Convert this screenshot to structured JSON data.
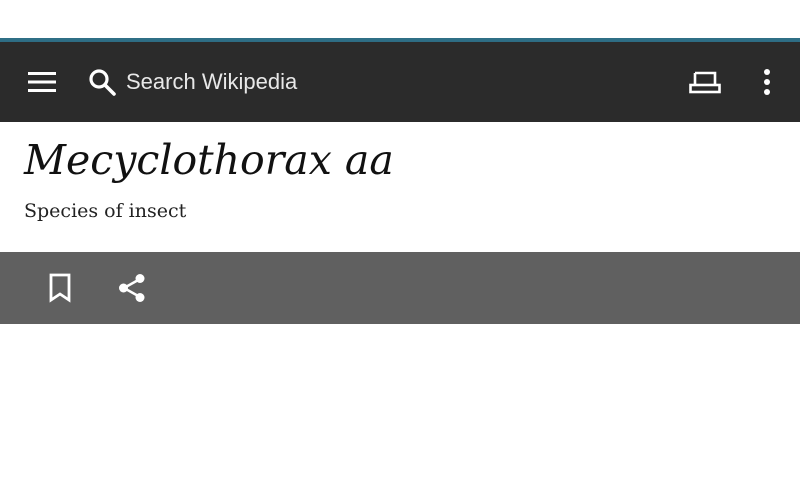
{
  "toolbar": {
    "search_placeholder": "Search Wikipedia",
    "icons": {
      "menu": "hamburger-menu-icon",
      "search": "search-icon",
      "tabs": "tabs-icon",
      "overflow": "more-vertical-icon"
    },
    "background_color": "#2b2b2b",
    "accent_color": "#2f6f86"
  },
  "article": {
    "title": "Mecyclothorax aa",
    "description": "Species of insect"
  },
  "action_bar": {
    "icons": {
      "bookmark": "bookmark-icon",
      "share": "share-icon"
    },
    "background_color": "#606060"
  }
}
